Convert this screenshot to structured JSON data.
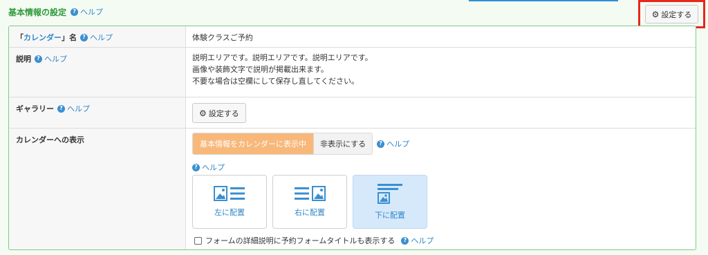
{
  "header": {
    "title": "基本情報の設定",
    "help_label": "ヘルプ",
    "settings_label": "設定する"
  },
  "rows": {
    "calendar_name": {
      "label_prefix": "「",
      "label_link": "カレンダー",
      "label_suffix": "」名",
      "help_label": "ヘルプ",
      "value": "体験クラスご予約"
    },
    "description": {
      "label": "説明",
      "help_label": "ヘルプ",
      "lines": [
        "説明エリアです。説明エリアです。説明エリアです。",
        "画像や装飾文字で説明が掲載出来ます。",
        "不要な場合は空欄にして保存し直してください。"
      ]
    },
    "gallery": {
      "label": "ギャラリー",
      "help_label": "ヘルプ",
      "settings_label": "設定する"
    },
    "calendar_display": {
      "label": "カレンダーへの表示",
      "toggle_on_label": "基本情報をカレンダーに表示中",
      "toggle_off_label": "非表示にする",
      "help_label": "ヘルプ",
      "layout_help_label": "ヘルプ",
      "layouts": [
        {
          "label": "左に配置",
          "icon": "image-left-icon",
          "selected": false
        },
        {
          "label": "右に配置",
          "icon": "image-right-icon",
          "selected": false
        },
        {
          "label": "下に配置",
          "icon": "image-bottom-icon",
          "selected": true
        }
      ],
      "checkbox_label": "フォームの詳細説明に予約フォームタイトルも表示する",
      "checkbox_checked": false,
      "checkbox_help_label": "ヘルプ"
    }
  },
  "colors": {
    "accent_green": "#2e9a3a",
    "link_blue": "#2f86c8",
    "toggle_active": "#f8b87a",
    "selected_card": "#d6e9fb",
    "highlight_red": "#e8261c"
  }
}
